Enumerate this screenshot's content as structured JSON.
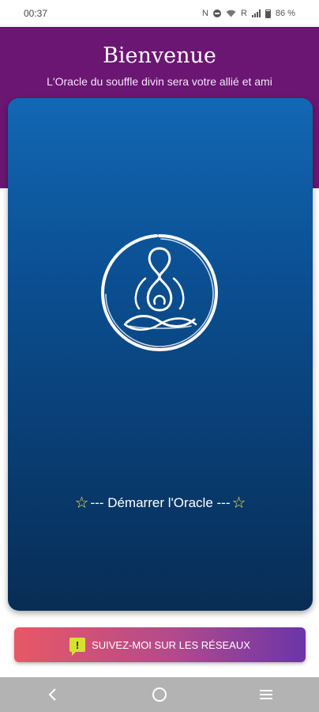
{
  "status_bar": {
    "time": "00:37",
    "indicators": [
      "N",
      "R"
    ],
    "battery": "86 %",
    "icons": [
      "nfc-icon",
      "dnd-icon",
      "wifi-icon",
      "signal-icon",
      "battery-icon"
    ]
  },
  "header": {
    "title": "Bienvenue",
    "subtitle": "L'Oracle du souffle divin sera votre allié et ami"
  },
  "card": {
    "logo_icon": "meditation-logo-icon",
    "start_star_left": "☆",
    "start_label": "--- Démarrer l'Oracle ---",
    "start_star_right": "☆"
  },
  "social_button": {
    "label": "SUIVEZ-MOI SUR LES RÉSEAUX",
    "icon": "alert-message-icon",
    "icon_glyph": "!"
  },
  "nav_bar": {
    "back_icon": "back-chevron-icon",
    "home_icon": "home-circle-icon",
    "recents_icon": "recents-menu-icon"
  },
  "colors": {
    "header_bg": "#6b1673",
    "card_top": "#1267b4",
    "card_bottom": "#082d55",
    "star": "#f4e04d",
    "button_left": "#e85866",
    "button_right": "#6b35a8",
    "nav_bg": "#b3b3b3"
  }
}
